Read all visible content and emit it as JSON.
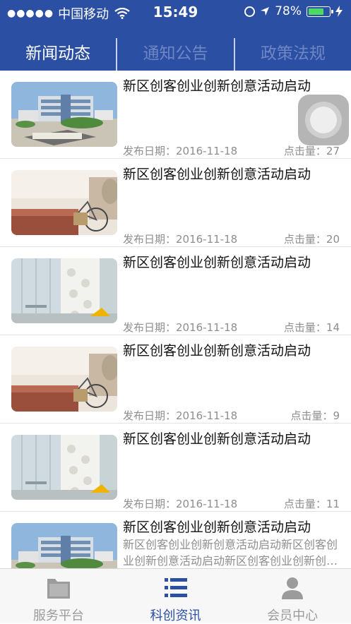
{
  "status_bar": {
    "carrier": "中国移动",
    "time": "15:49",
    "battery": "78%",
    "battery_level": 0.78
  },
  "tabs": [
    {
      "label": "新闻动态",
      "active": true
    },
    {
      "label": "通知公告",
      "active": false
    },
    {
      "label": "政策法规",
      "active": false
    }
  ],
  "news": [
    {
      "title": "新区创客创业创新创意活动启动",
      "date_label": "发布日期：2016-11-18",
      "clicks_label": "点击量：27",
      "image": "building"
    },
    {
      "title": "新区创客创业创新创意活动启动",
      "date_label": "发布日期：2016-11-18",
      "clicks_label": "点击量：20",
      "image": "bicycle"
    },
    {
      "title": "新区创客创业创新创意活动启动",
      "date_label": "发布日期：2016-11-18",
      "clicks_label": "点击量：14",
      "image": "office"
    },
    {
      "title": "新区创客创业创新创意活动启动",
      "date_label": "发布日期：2016-11-18",
      "clicks_label": "点击量：9",
      "image": "bicycle"
    },
    {
      "title": "新区创客创业创新创意活动启动",
      "date_label": "发布日期：2016-11-18",
      "clicks_label": "点击量：11",
      "image": "office"
    },
    {
      "title": "新区创客创业创新创意活动启动",
      "summary": "新区创客创业创新创意活动启动新区创客创业创新创意活动启动新区创客创业创新创意活动启动",
      "image": "building"
    }
  ],
  "bottom_nav": [
    {
      "label": "服务平台",
      "icon": "folder-icon",
      "active": false
    },
    {
      "label": "科创资讯",
      "icon": "list-icon",
      "active": true
    },
    {
      "label": "会员中心",
      "icon": "person-icon",
      "active": false
    }
  ],
  "colors": {
    "header": "#2b4fa3",
    "active_nav": "#2b4fa3",
    "battery_fill": "#4cd964"
  }
}
